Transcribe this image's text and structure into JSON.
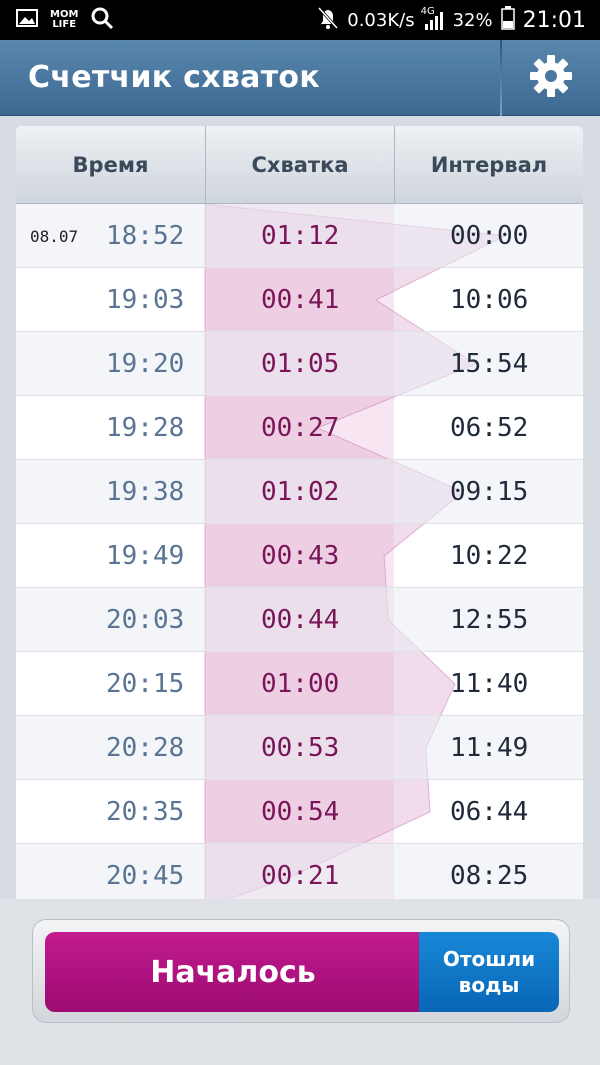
{
  "status_bar": {
    "app_badge": "MOM\nLIFE",
    "net_speed": "0.03K/s",
    "network": "4G",
    "battery": "32%",
    "clock": "21:01"
  },
  "app_bar": {
    "title": "Счетчик схваток"
  },
  "table": {
    "headers": [
      "Время",
      "Схватка",
      "Интервал"
    ],
    "rows": [
      {
        "date": "08.07",
        "time": "18:52",
        "duration": "01:12",
        "interval": "00:00"
      },
      {
        "date": "",
        "time": "19:03",
        "duration": "00:41",
        "interval": "10:06"
      },
      {
        "date": "",
        "time": "19:20",
        "duration": "01:05",
        "interval": "15:54"
      },
      {
        "date": "",
        "time": "19:28",
        "duration": "00:27",
        "interval": "06:52"
      },
      {
        "date": "",
        "time": "19:38",
        "duration": "01:02",
        "interval": "09:15"
      },
      {
        "date": "",
        "time": "19:49",
        "duration": "00:43",
        "interval": "10:22"
      },
      {
        "date": "",
        "time": "20:03",
        "duration": "00:44",
        "interval": "12:55"
      },
      {
        "date": "",
        "time": "20:15",
        "duration": "01:00",
        "interval": "11:40"
      },
      {
        "date": "",
        "time": "20:28",
        "duration": "00:53",
        "interval": "11:49"
      },
      {
        "date": "",
        "time": "20:35",
        "duration": "00:54",
        "interval": "06:44"
      },
      {
        "date": "",
        "time": "20:45",
        "duration": "00:21",
        "interval": "08:25"
      }
    ]
  },
  "buttons": {
    "start": "Началось",
    "water_broke": "Отошли воды"
  },
  "colors": {
    "accent_magenta": "#b0127f",
    "accent_blue": "#0b73c6",
    "app_bar": "#4a78a0"
  },
  "icons": {
    "settings": "gear-icon",
    "gallery": "image-icon",
    "search": "search-icon",
    "mute": "bell-off-icon",
    "signal": "signal-icon",
    "battery": "battery-icon"
  }
}
